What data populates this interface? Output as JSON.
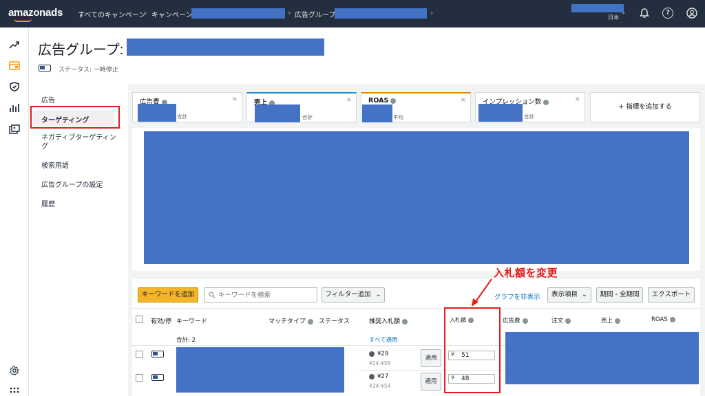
{
  "topbar": {
    "logo": "amazonads",
    "crumbs": [
      "すべてのキャンペーン",
      "キャンペーン:",
      "広告グループ:"
    ],
    "locale": "日本"
  },
  "header": {
    "title": "広告グループ:",
    "status": "ステータス: 一時停止"
  },
  "subnav": {
    "items": [
      "広告",
      "ターゲティング",
      "ネガティブターゲティング",
      "検索用語",
      "広告グループの設定",
      "履歴"
    ]
  },
  "metrics": [
    {
      "name": "広告費",
      "agg": "合計",
      "accent": ""
    },
    {
      "name": "売上",
      "agg": "合計",
      "accent": "#1f8fc5"
    },
    {
      "name": "ROAS",
      "agg": "平均",
      "accent": "#e18a00"
    },
    {
      "name": "インプレッション数",
      "agg": "合計",
      "accent": ""
    }
  ],
  "add_metric": "+ 指標を追加する",
  "toolbar": {
    "add_keyword": "キーワードを追加",
    "search_placeholder": "キーワードを検索",
    "add_filter": "フィルター追加",
    "hide_graph": "グラフを非表示",
    "columns": "表示項目",
    "period": "期間 - 全期間",
    "export": "エクスポート"
  },
  "table": {
    "headers": [
      "有効/停",
      "キーワード",
      "マッチタイプ",
      "ステータス",
      "推奨入札額",
      "入札額",
      "広告費",
      "注文",
      "売上",
      "ROAS"
    ],
    "total_label": "合計: 2",
    "apply_all": "すべて適用",
    "apply": "適用",
    "currency": "¥",
    "rows": [
      {
        "suggested": "¥29",
        "range": "¥24-¥58",
        "bid": "51"
      },
      {
        "suggested": "¥27",
        "range": "¥24-¥54",
        "bid": "48"
      }
    ]
  },
  "annotation": "入札額を変更",
  "colors": {
    "topbar": "#232f3e",
    "redact": "#4472c4",
    "highlight": "#e41b1b",
    "primary_button": "#f5b52a"
  }
}
